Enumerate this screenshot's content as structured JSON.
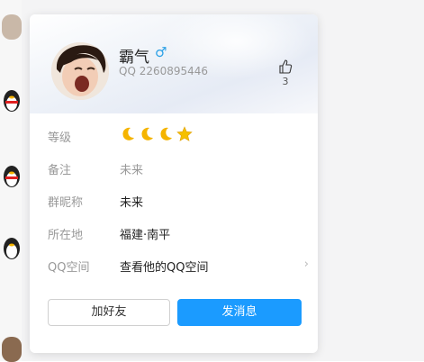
{
  "profile": {
    "name": "霸气",
    "gender_symbol": "♂",
    "qq_number": "QQ 2260895446",
    "like_count": "3"
  },
  "fields": {
    "level_label": "等级",
    "remark_label": "备注",
    "remark_value": "未来",
    "group_nick_label": "群昵称",
    "group_nick_value": "未来",
    "location_label": "所在地",
    "location_value": "福建·南平",
    "qzone_label": "QQ空间",
    "qzone_value": "查看他的QQ空间"
  },
  "level_icons": [
    "moon",
    "moon",
    "moon",
    "star"
  ],
  "buttons": {
    "add_friend": "加好友",
    "send_message": "发消息"
  },
  "colors": {
    "accent": "#1b9bff",
    "gender": "#2ba0e6",
    "moon": "#f5b400"
  }
}
